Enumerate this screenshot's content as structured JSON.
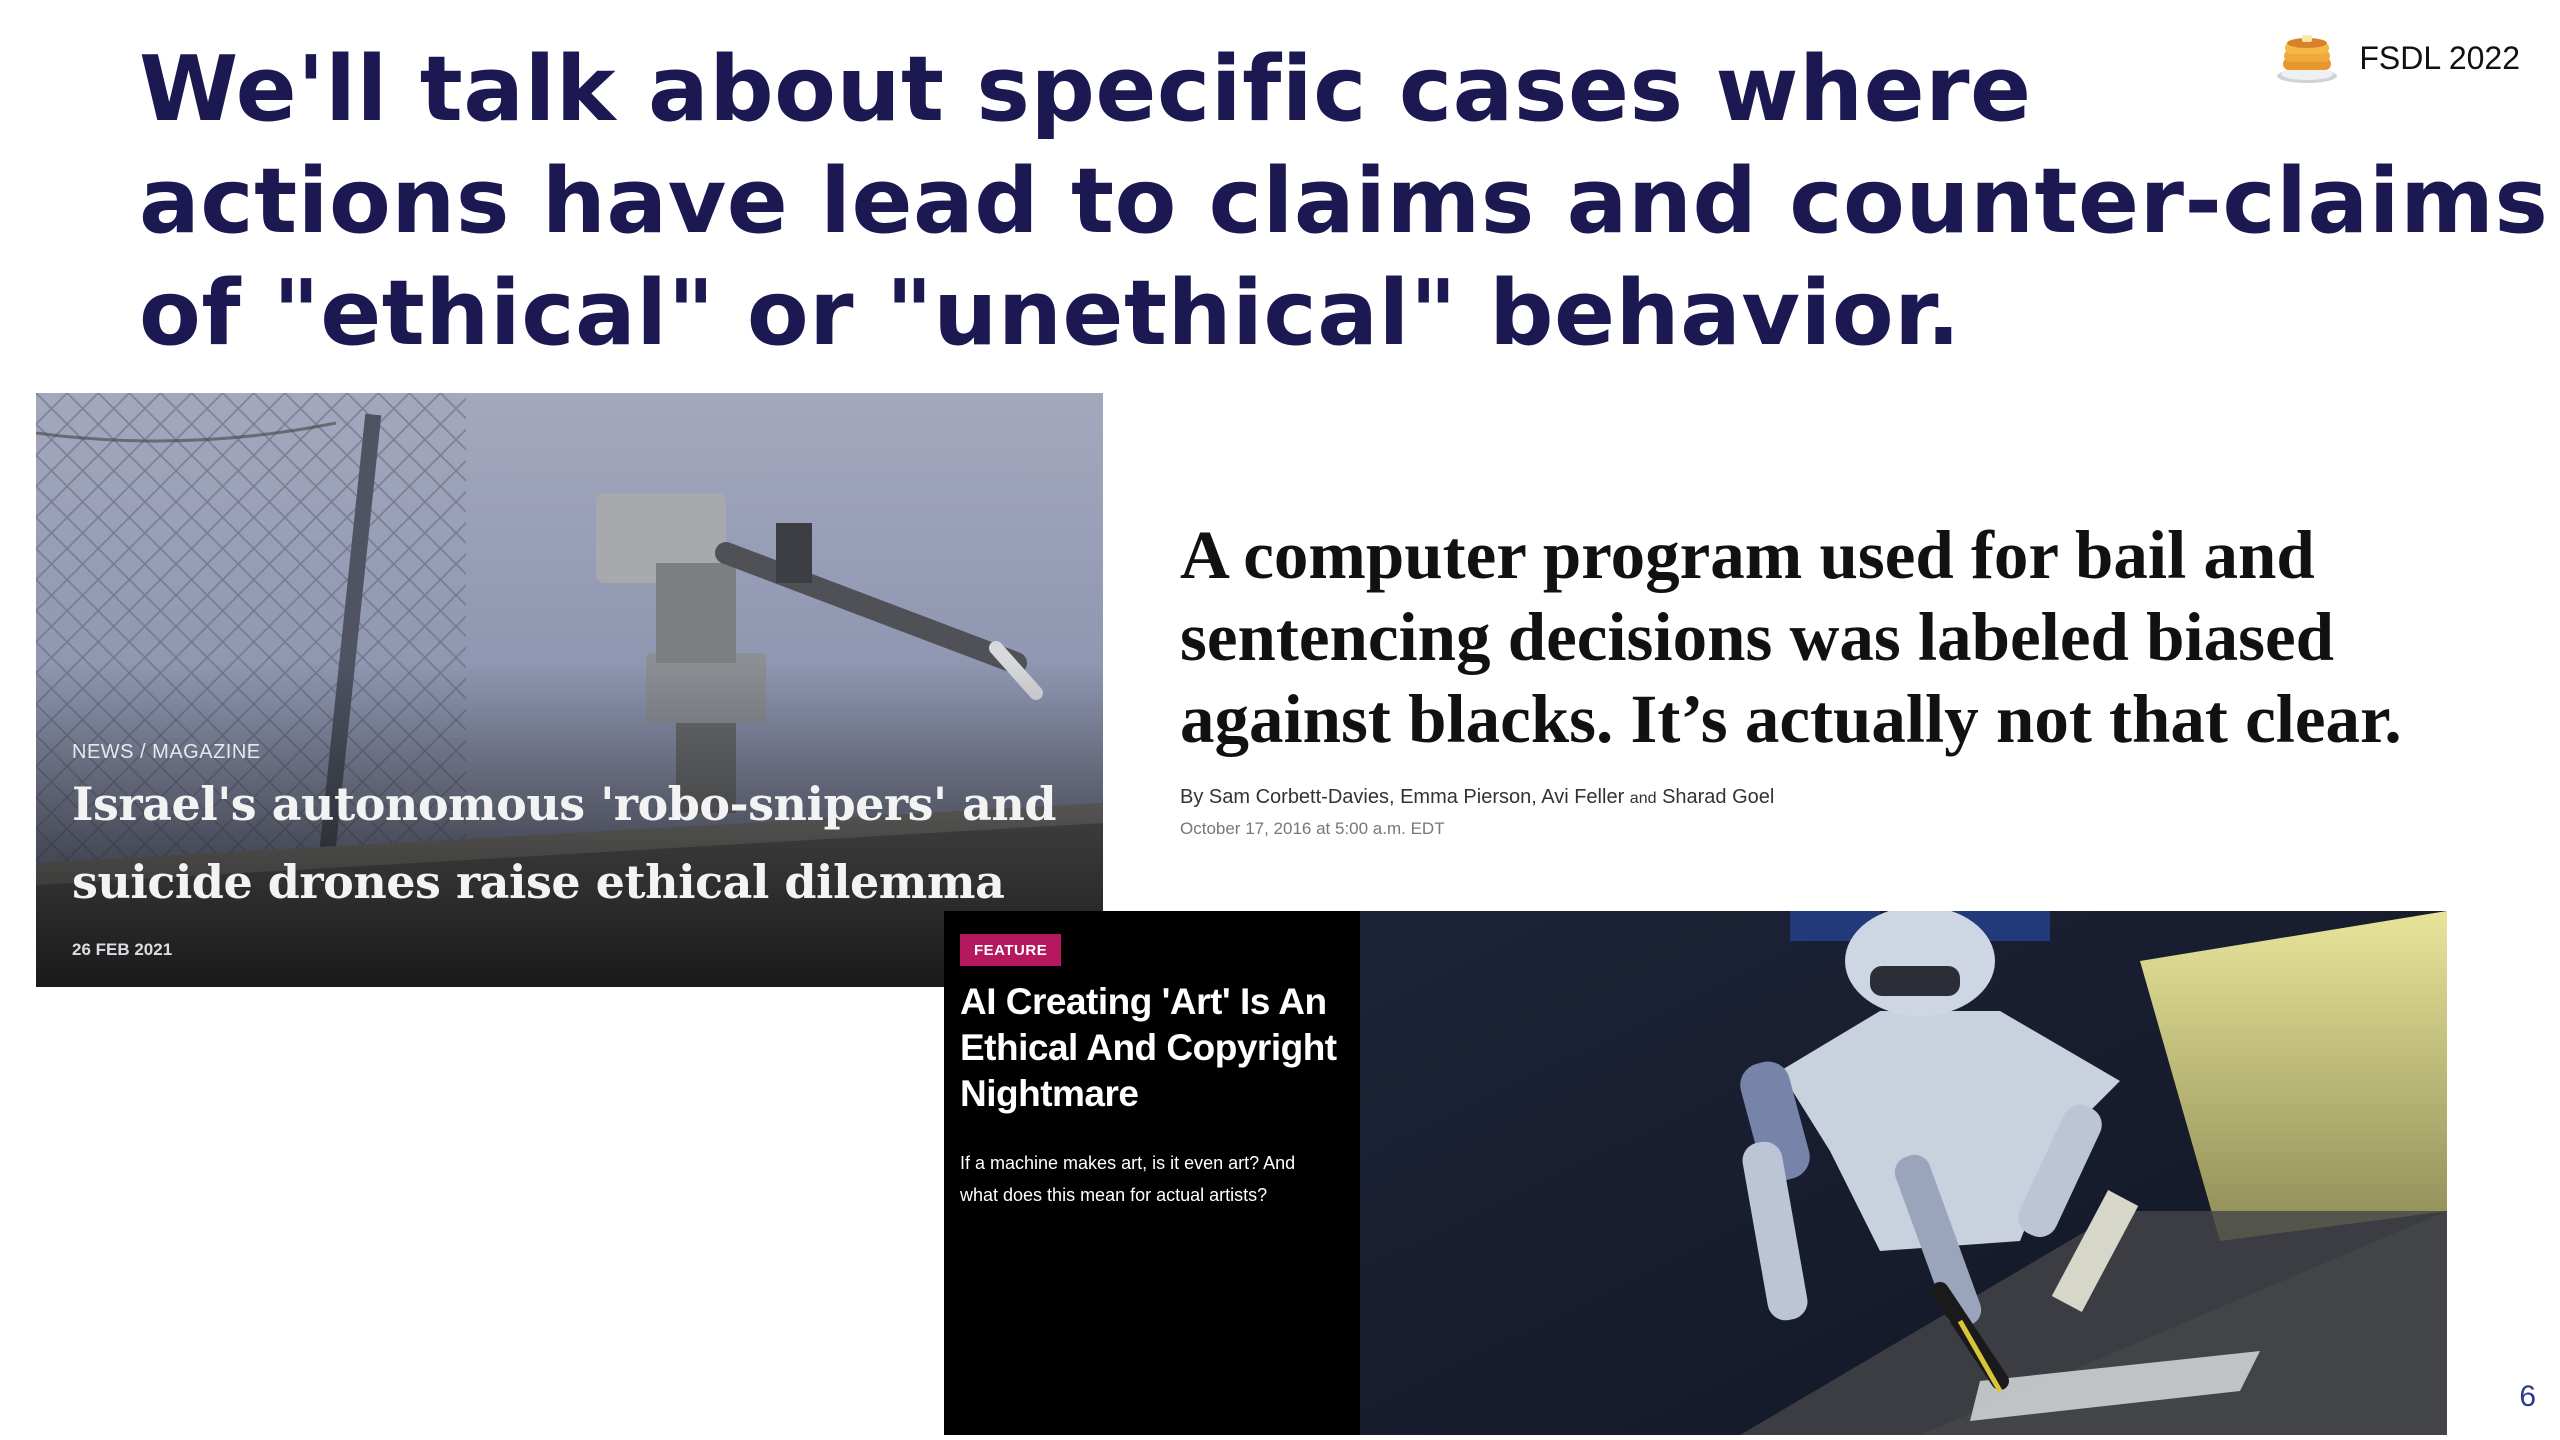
{
  "slide": {
    "title_lines": [
      "We'll talk about specific cases where",
      "actions have lead to claims and counter-claims",
      "of \"ethical\" or \"unethical\" behavior."
    ],
    "brand": {
      "icon": "pancake-icon",
      "label": "FSDL 2022"
    },
    "page_number": "6"
  },
  "articles": {
    "drones": {
      "section": "NEWS / MAGAZINE",
      "headline_lines": [
        "Israel's autonomous 'robo-snipers' and",
        "suicide drones raise ethical dilemma"
      ],
      "date": "26 FEB 2021"
    },
    "bail": {
      "headline_lines": [
        "A computer program used for bail and",
        "sentencing decisions was labeled biased",
        "against blacks. It’s actually not that clear."
      ],
      "byline": {
        "prefix": "By",
        "authors": "Sam Corbett-Davies, Emma Pierson, Avi Feller",
        "conjunction": "and",
        "last_author": "Sharad Goel"
      },
      "timestamp": "October 17, 2016 at 5:00 a.m. EDT"
    },
    "ai_art": {
      "badge": "FEATURE",
      "headline_lines": [
        "AI Creating 'Art' Is An",
        "Ethical And Copyright",
        "Nightmare"
      ],
      "dek_lines": [
        "If a machine makes art, is it even art? And",
        "what does this mean for actual artists?"
      ]
    }
  },
  "colors": {
    "title": "#1c1852",
    "badge": "#b5185d",
    "page_number": "#2a3a8f"
  }
}
